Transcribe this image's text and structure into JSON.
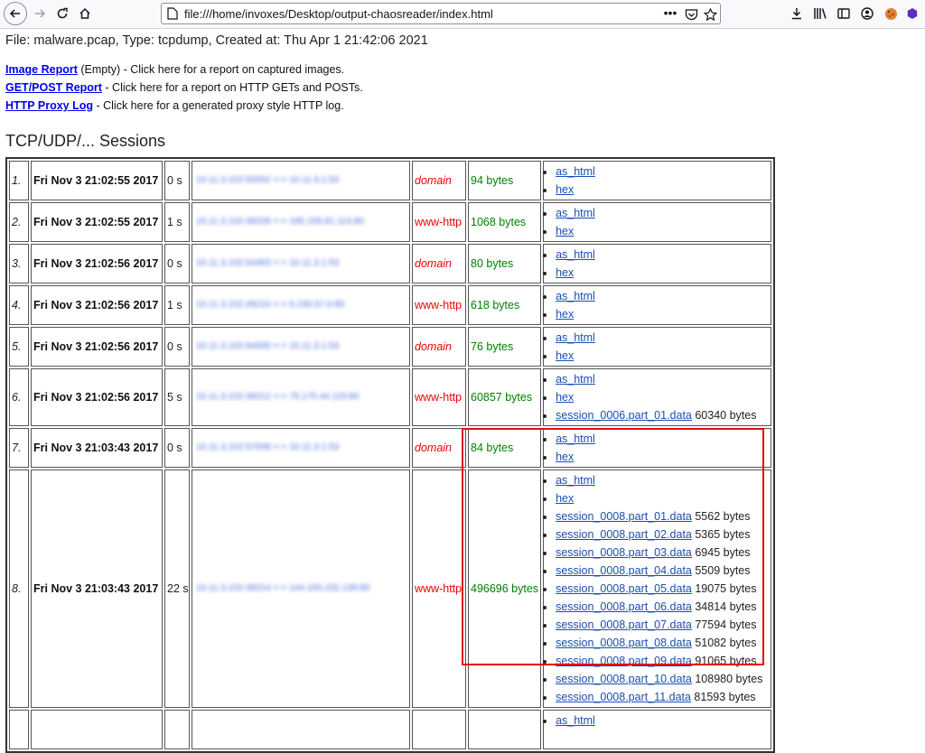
{
  "browser": {
    "url": "file:///home/invoxes/Desktop/output-chaosreader/index.html",
    "more_glyph": "•••",
    "accent_color": "#e01010"
  },
  "page": {
    "file_info": "File: malware.pcap, Type: tcpdump, Created at: Thu Apr 1 21:42:06 2021",
    "reports": [
      {
        "link": "Image Report",
        "text": " (Empty) - Click here for a report on captured images."
      },
      {
        "link": "GET/POST Report",
        "text": " - Click here for a report on HTTP GETs and POSTs."
      },
      {
        "link": "HTTP Proxy Log",
        "text": " - Click here for a generated proxy style HTTP log."
      }
    ],
    "sessions_heading": "TCP/UDP/... Sessions"
  },
  "sessions": [
    {
      "num": "1.",
      "date": "Fri Nov 3 21:02:55 2017",
      "duration": "0 s",
      "address": "10.11.3.102:50052 <-> 10.11.3.1:53",
      "service": "domain",
      "size": "94 bytes",
      "links": [
        {
          "label": "as_html"
        },
        {
          "label": "hex"
        }
      ]
    },
    {
      "num": "2.",
      "date": "Fri Nov 3 21:02:55 2017",
      "duration": "1 s",
      "address": "10.11.3.102:49208 <-> 185.159.81.114:80",
      "service": "www-http",
      "size": "1068 bytes",
      "links": [
        {
          "label": "as_html"
        },
        {
          "label": "hex"
        }
      ]
    },
    {
      "num": "3.",
      "date": "Fri Nov 3 21:02:56 2017",
      "duration": "0 s",
      "address": "10.11.3.102:54493 <-> 10.11.3.1:53",
      "service": "domain",
      "size": "80 bytes",
      "links": [
        {
          "label": "as_html"
        },
        {
          "label": "hex"
        }
      ]
    },
    {
      "num": "4.",
      "date": "Fri Nov 3 21:02:56 2017",
      "duration": "1 s",
      "address": "10.11.3.102:49210 <-> 5.230.57.6:80",
      "service": "www-http",
      "size": "618 bytes",
      "links": [
        {
          "label": "as_html"
        },
        {
          "label": "hex"
        }
      ]
    },
    {
      "num": "5.",
      "date": "Fri Nov 3 21:02:56 2017",
      "duration": "0 s",
      "address": "10.11.3.102:64600 <-> 10.11.3.1:53",
      "service": "domain",
      "size": "76 bytes",
      "links": [
        {
          "label": "as_html"
        },
        {
          "label": "hex"
        }
      ]
    },
    {
      "num": "6.",
      "date": "Fri Nov 3 21:02:56 2017",
      "duration": "5 s",
      "address": "10.11.3.102:49212 <-> 75.170.44.115:80",
      "service": "www-http",
      "size": "60857 bytes",
      "links": [
        {
          "label": "as_html"
        },
        {
          "label": "hex"
        },
        {
          "label": "session_0006.part_01.data",
          "size": " 60340 bytes"
        }
      ]
    },
    {
      "num": "7.",
      "date": "Fri Nov 3 21:03:43 2017",
      "duration": "0 s",
      "address": "10.11.3.102:57008 <-> 10.11.3.1:53",
      "service": "domain",
      "size": "84 bytes",
      "links": [
        {
          "label": "as_html"
        },
        {
          "label": "hex"
        }
      ]
    },
    {
      "num": "8.",
      "date": "Fri Nov 3 21:03:43 2017",
      "duration": "22 s",
      "address": "10.11.3.102:49214 <-> 144.193.232.139:80",
      "service": "www-http",
      "size": "496696 bytes",
      "links": [
        {
          "label": "as_html"
        },
        {
          "label": "hex"
        },
        {
          "label": "session_0008.part_01.data",
          "size": " 5562 bytes"
        },
        {
          "label": "session_0008.part_02.data",
          "size": " 5365 bytes"
        },
        {
          "label": "session_0008.part_03.data",
          "size": " 6945 bytes"
        },
        {
          "label": "session_0008.part_04.data",
          "size": " 5509 bytes"
        },
        {
          "label": "session_0008.part_05.data",
          "size": " 19075 bytes"
        },
        {
          "label": "session_0008.part_06.data",
          "size": " 34814 bytes"
        },
        {
          "label": "session_0008.part_07.data",
          "size": " 77594 bytes"
        },
        {
          "label": "session_0008.part_08.data",
          "size": " 51082 bytes"
        },
        {
          "label": "session_0008.part_09.data",
          "size": " 91065 bytes"
        },
        {
          "label": "session_0008.part_10.data",
          "size": " 108980 bytes"
        },
        {
          "label": "session_0008.part_11.data",
          "size": " 81593 bytes"
        }
      ]
    },
    {
      "num": "",
      "date": "",
      "duration": "",
      "address": "",
      "service": "",
      "size": "",
      "links": [
        {
          "label": "as_html"
        }
      ]
    }
  ]
}
